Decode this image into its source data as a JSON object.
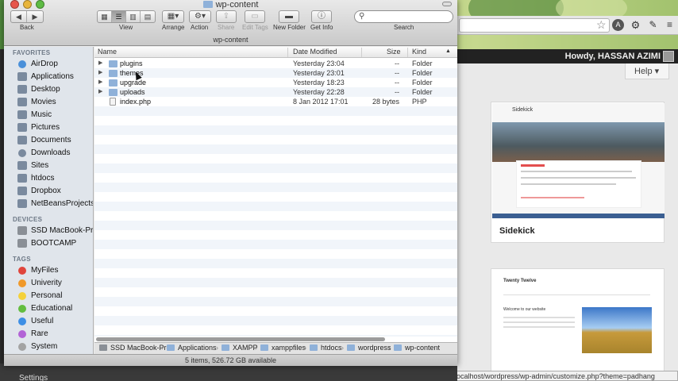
{
  "window": {
    "title": "wp-content",
    "path_title": "wp-content"
  },
  "toolbar": {
    "back_label": "Back",
    "view_label": "View",
    "arrange_label": "Arrange",
    "action_label": "Action",
    "share_label": "Share",
    "edit_tags_label": "Edit Tags",
    "new_folder_label": "New Folder",
    "get_info_label": "Get Info",
    "search_label": "Search",
    "search_placeholder": ""
  },
  "sidebar": {
    "favorites_header": "FAVORITES",
    "favorites": [
      {
        "label": "AirDrop",
        "icon": "airdrop-icon"
      },
      {
        "label": "Applications",
        "icon": "applications-icon"
      },
      {
        "label": "Desktop",
        "icon": "desktop-icon"
      },
      {
        "label": "Movies",
        "icon": "movies-icon"
      },
      {
        "label": "Music",
        "icon": "music-icon"
      },
      {
        "label": "Pictures",
        "icon": "pictures-icon"
      },
      {
        "label": "Documents",
        "icon": "documents-icon"
      },
      {
        "label": "Downloads",
        "icon": "downloads-icon"
      },
      {
        "label": "Sites",
        "icon": "folder-icon"
      },
      {
        "label": "htdocs",
        "icon": "folder-icon"
      },
      {
        "label": "Dropbox",
        "icon": "folder-icon"
      },
      {
        "label": "NetBeansProjects",
        "icon": "folder-icon"
      }
    ],
    "devices_header": "DEVICES",
    "devices": [
      {
        "label": "SSD MacBook-Pro",
        "icon": "hard-drive-icon"
      },
      {
        "label": "BOOTCAMP",
        "icon": "hard-drive-icon"
      }
    ],
    "tags_header": "TAGS",
    "tags": [
      {
        "label": "MyFiles",
        "color": "#e0453c"
      },
      {
        "label": "Univerity",
        "color": "#f0992a"
      },
      {
        "label": "Personal",
        "color": "#f4d13b"
      },
      {
        "label": "Educational",
        "color": "#63bd3f"
      },
      {
        "label": "Useful",
        "color": "#3d8fe5"
      },
      {
        "label": "Rare",
        "color": "#b263d6"
      },
      {
        "label": "System",
        "color": "#a3a3a3"
      }
    ]
  },
  "list": {
    "columns": {
      "name": "Name",
      "date": "Date Modified",
      "size": "Size",
      "kind": "Kind"
    },
    "rows": [
      {
        "name": "plugins",
        "date": "Yesterday 23:04",
        "size": "--",
        "kind": "Folder",
        "is_folder": true
      },
      {
        "name": "themes",
        "date": "Yesterday 23:01",
        "size": "--",
        "kind": "Folder",
        "is_folder": true
      },
      {
        "name": "upgrade",
        "date": "Yesterday 18:23",
        "size": "--",
        "kind": "Folder",
        "is_folder": true
      },
      {
        "name": "uploads",
        "date": "Yesterday 22:28",
        "size": "--",
        "kind": "Folder",
        "is_folder": true
      },
      {
        "name": "index.php",
        "date": "8 Jan 2012 17:01",
        "size": "28 bytes",
        "kind": "PHP",
        "is_folder": false
      }
    ]
  },
  "pathbar": [
    "SSD MacBook-Pro",
    "Applications",
    "XAMPP",
    "xamppfiles",
    "htdocs",
    "wordpress",
    "wp-content"
  ],
  "status": "5 items, 526.72 GB available",
  "background": {
    "howdy": "Howdy, HASSAN AZIMI",
    "help": "Help",
    "theme1_name": "Sidekick",
    "theme1_header": "Sidekick",
    "theme2_header": "Twenty Twelve",
    "theme2_welcome": "Welcome to our website",
    "statusbar_url": "localhost/wordpress/wp-admin/customize.php?theme=padhang",
    "settings_label": "Settings"
  },
  "colors": {
    "folder": "#8fb1d9",
    "sidebar_bg": "#e0e5eb",
    "wp_adminbar": "#222222"
  }
}
